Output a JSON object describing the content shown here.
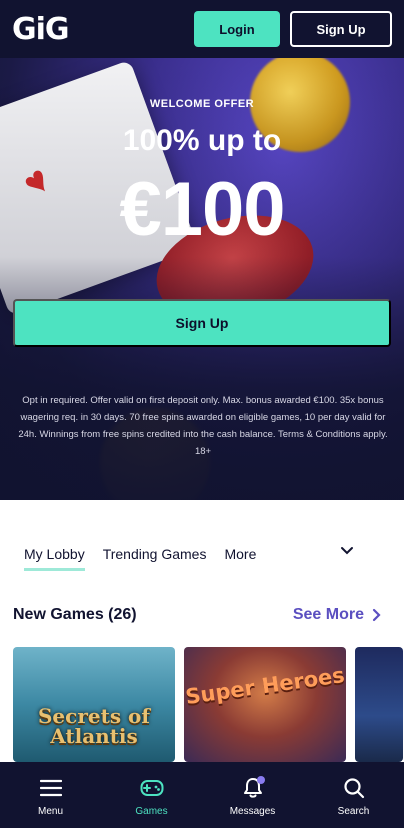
{
  "header": {
    "logo": "GiG",
    "login_label": "Login",
    "signup_label": "Sign Up"
  },
  "hero": {
    "welcome": "WELCOME OFFER",
    "headline": "100% up to",
    "amount": "€100",
    "signup_label": "Sign Up",
    "terms": "Opt in required. Offer valid on first deposit only. Max. bonus awarded €100. 35x bonus wagering req. in 30 days. 70 free spins awarded on eligible games, 10 per day valid for 24h. Winnings from free spins credited into the cash balance. Terms & Conditions apply. 18+"
  },
  "tabs": {
    "items": [
      {
        "label": "My Lobby"
      },
      {
        "label": "Trending Games"
      },
      {
        "label": "More"
      }
    ]
  },
  "section": {
    "title": "New Games (26)",
    "see_more": "See More"
  },
  "games": [
    {
      "title": "Secrets of Atlantis"
    },
    {
      "title": "Super Heroes"
    }
  ],
  "nav": {
    "items": [
      {
        "label": "Menu",
        "icon": "menu-icon"
      },
      {
        "label": "Games",
        "icon": "gamepad-icon"
      },
      {
        "label": "Messages",
        "icon": "bell-icon"
      },
      {
        "label": "Search",
        "icon": "search-icon"
      }
    ]
  },
  "colors": {
    "accent": "#4de3c1",
    "dark": "#111330",
    "link": "#5b4fc0"
  }
}
